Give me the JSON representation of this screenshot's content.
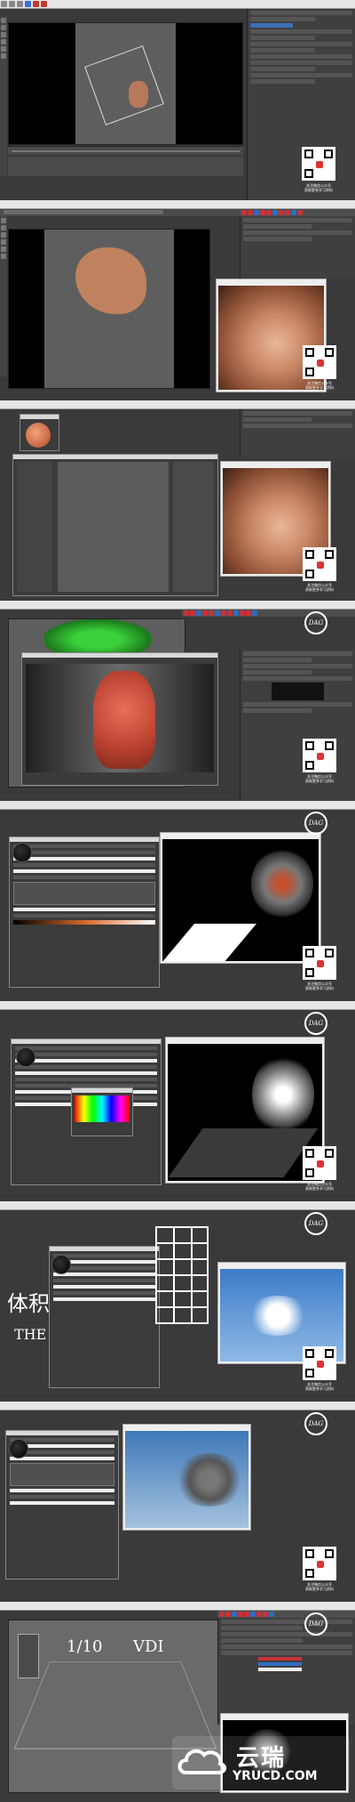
{
  "qr_caption": {
    "line1": "关注微信公众号",
    "line2": "获取更多学习资料"
  },
  "dac_badge": "DAG",
  "handwriting": {
    "panel7_a": "体积",
    "panel7_b": "THE",
    "panel9_a": "1/10",
    "panel9_b": "VDI"
  },
  "watermark": {
    "cn": "云瑞",
    "en": "YRUCD.COM"
  },
  "colors": {
    "accent_red": "#c8323a",
    "accent_blue": "#2f6cc4",
    "panel_bg": "#3a3a3a"
  }
}
